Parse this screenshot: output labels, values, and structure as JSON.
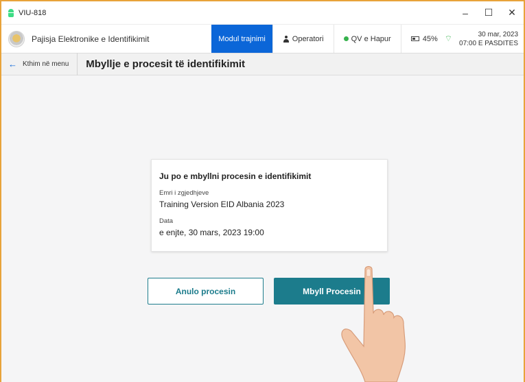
{
  "window": {
    "title": "VIU-818",
    "minimize": "–",
    "maximize": "☐",
    "close": "✕"
  },
  "appbar": {
    "title": "Pajisja Elektronike e Identifikimit",
    "mode": "Modul trajnimi",
    "operator": "Operatori",
    "status": "QV e Hapur",
    "status_color": "#37b24d",
    "battery": "45%",
    "date": "30 mar, 2023",
    "time": "07:00 E PASDITES"
  },
  "nav": {
    "back_label": "Kthim në menu",
    "page_title": "Mbyllje e procesit të identifikimit"
  },
  "card": {
    "title": "Ju po e mbyllni procesin e identifikimit",
    "election_label": "Emri i zgjedhjeve",
    "election_value": "Training Version EID Albania 2023",
    "date_label": "Data",
    "date_value": "e enjte, 30 mars, 2023 19:00"
  },
  "actions": {
    "cancel_label": "Anulo procesin",
    "close_label": "Mbyll Procesin"
  },
  "colors": {
    "accent": "#1c7c8c",
    "mode_bg": "#0b66d8",
    "frame": "#e8a33a"
  },
  "icons": [
    "android-icon",
    "logo-emblem",
    "person-icon",
    "status-dot-icon",
    "battery-icon",
    "wifi-icon",
    "back-arrow-icon",
    "pointing-hand-image"
  ]
}
